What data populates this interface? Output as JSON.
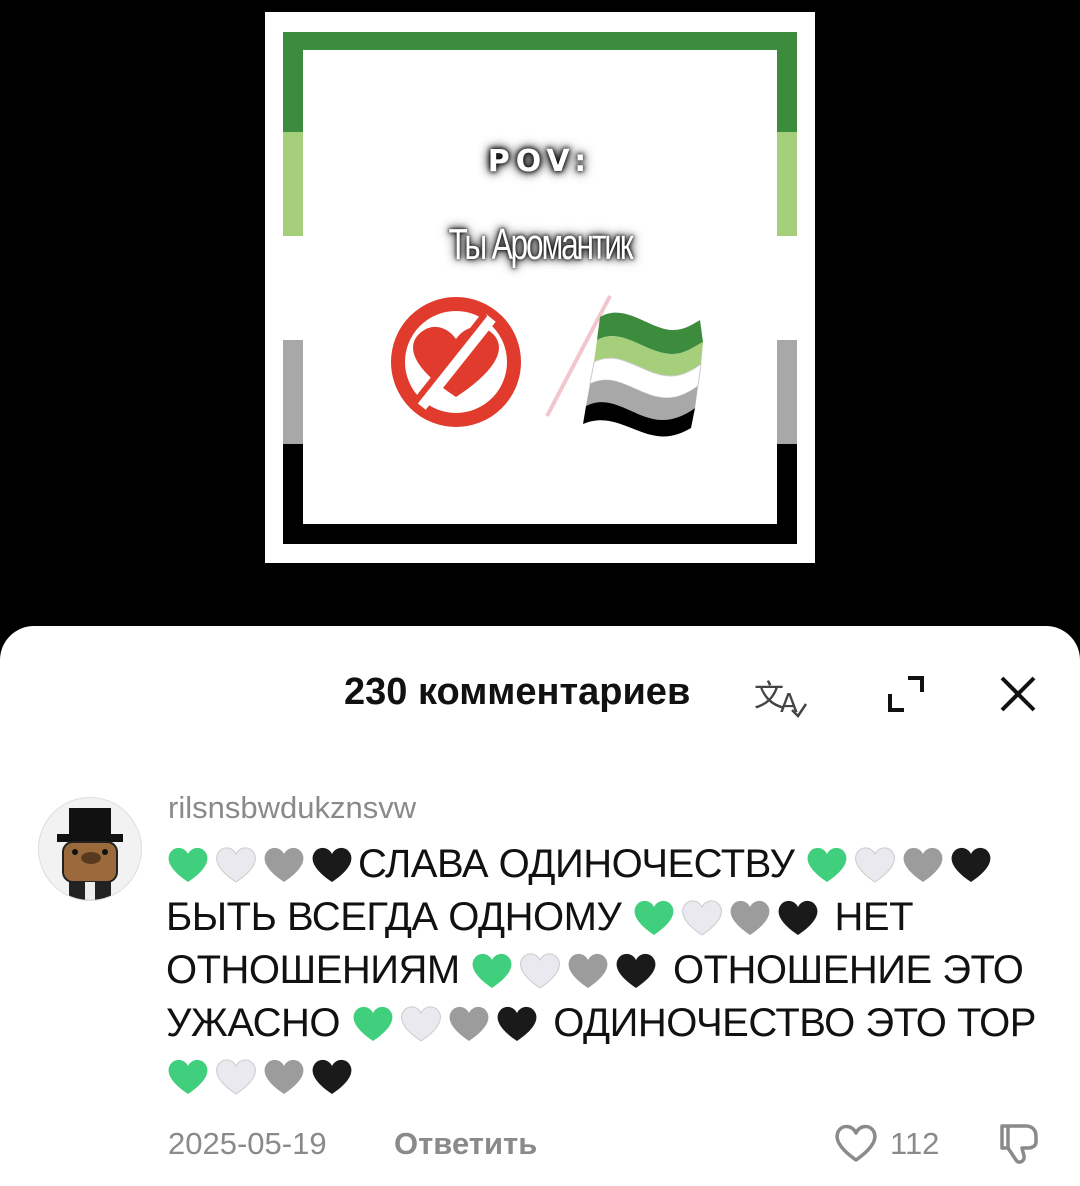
{
  "video": {
    "pov_text": "POV:",
    "subtitle": "Ты Аромантик"
  },
  "comments_panel": {
    "title": "230 комментариев",
    "icons": {
      "translate": "translate-icon",
      "expand": "expand-icon",
      "close": "close-icon"
    }
  },
  "comment": {
    "username": "rilsnsbwdukznsvw",
    "segments": [
      "СЛАВА ОДИНОЧЕСТВУ",
      "БЫТЬ ВСЕГДА ОДНОМУ",
      "НЕТ ОТНОШЕНИЯМ",
      "ОТНОШЕНИЕ ЭТО УЖАСНО",
      "ОДИНОЧЕСТВО ЭТО ТОР"
    ],
    "date": "2025-05-19",
    "reply_label": "Ответить",
    "like_count": "112"
  },
  "colors": {
    "flag_green": "#3d8c3d",
    "flag_lightgreen": "#a5cf7a",
    "flag_grey": "#a8a8a8",
    "flag_black": "#000000",
    "nolove_red": "#e03b2c",
    "heart_green": "#3fcf7d"
  }
}
